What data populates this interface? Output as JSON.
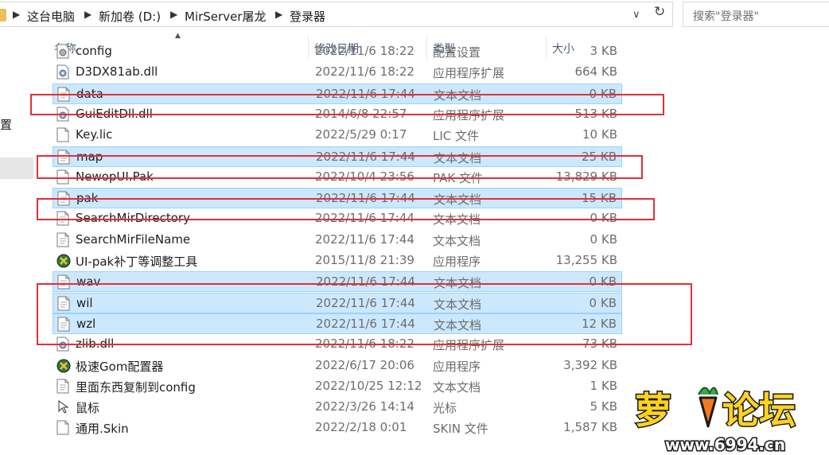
{
  "address_bar": {
    "breadcrumbs": [
      "这台电脑",
      "新加卷 (D:)",
      "MirServer屠龙",
      "登录器"
    ],
    "search_placeholder": "搜索\"登录器\""
  },
  "nav": {
    "partial_label": "置"
  },
  "columns": {
    "name": "名称",
    "date": "修改日期",
    "type": "类型",
    "size": "大小"
  },
  "files": [
    {
      "name": "config",
      "date": "2022/11/6 18:22",
      "type": "配置设置",
      "size": "3 KB",
      "icon": "config-file-icon",
      "selected": false
    },
    {
      "name": "D3DX81ab.dll",
      "date": "2022/11/6 18:22",
      "type": "应用程序扩展",
      "size": "664 KB",
      "icon": "dll-file-icon",
      "selected": false
    },
    {
      "name": "data",
      "date": "2022/11/6 17:44",
      "type": "文本文档",
      "size": "0 KB",
      "icon": "text-file-icon",
      "selected": true
    },
    {
      "name": "GuiEditDll.dll",
      "date": "2014/6/8 22:57",
      "type": "应用程序扩展",
      "size": "513 KB",
      "icon": "dll-file-icon",
      "selected": false
    },
    {
      "name": "Key.lic",
      "date": "2022/5/29 0:17",
      "type": "LIC 文件",
      "size": "10 KB",
      "icon": "generic-file-icon",
      "selected": false
    },
    {
      "name": "map",
      "date": "2022/11/6 17:44",
      "type": "文本文档",
      "size": "25 KB",
      "icon": "text-file-icon",
      "selected": true
    },
    {
      "name": "NewopUI.Pak",
      "date": "2022/10/4 23:56",
      "type": "PAK 文件",
      "size": "13,829 KB",
      "icon": "generic-file-icon",
      "selected": false
    },
    {
      "name": "pak",
      "date": "2022/11/6 17:44",
      "type": "文本文档",
      "size": "15 KB",
      "icon": "text-file-icon",
      "selected": true
    },
    {
      "name": "SearchMirDirectory",
      "date": "2022/11/6 17:44",
      "type": "文本文档",
      "size": "0 KB",
      "icon": "text-file-icon",
      "selected": false
    },
    {
      "name": "SearchMirFileName",
      "date": "2022/11/6 17:44",
      "type": "文本文档",
      "size": "0 KB",
      "icon": "text-file-icon",
      "selected": false
    },
    {
      "name": "UI-pak补丁等调整工具",
      "date": "2015/11/8 21:39",
      "type": "应用程序",
      "size": "13,255 KB",
      "icon": "application-icon",
      "selected": false
    },
    {
      "name": "wav",
      "date": "2022/11/6 17:44",
      "type": "文本文档",
      "size": "0 KB",
      "icon": "text-file-icon",
      "selected": true
    },
    {
      "name": "wil",
      "date": "2022/11/6 17:44",
      "type": "文本文档",
      "size": "0 KB",
      "icon": "text-file-icon",
      "selected": true
    },
    {
      "name": "wzl",
      "date": "2022/11/6 17:44",
      "type": "文本文档",
      "size": "12 KB",
      "icon": "text-file-icon",
      "selected": true
    },
    {
      "name": "zlib.dll",
      "date": "2022/11/6 18:22",
      "type": "应用程序扩展",
      "size": "73 KB",
      "icon": "dll-file-icon",
      "selected": false
    },
    {
      "name": "极速Gom配置器",
      "date": "2022/6/17 20:06",
      "type": "应用程序",
      "size": "3,392 KB",
      "icon": "application-icon",
      "selected": false
    },
    {
      "name": "里面东西复制到config",
      "date": "2022/10/25 12:12",
      "type": "文本文档",
      "size": "1 KB",
      "icon": "text-file-icon",
      "selected": false
    },
    {
      "name": "鼠标",
      "date": "2022/3/26 14:14",
      "type": "光标",
      "size": "5 KB",
      "icon": "cursor-file-icon",
      "selected": false
    },
    {
      "name": "通用.Skin",
      "date": "2022/2/18 0:01",
      "type": "SKIN 文件",
      "size": "1,587 KB",
      "icon": "generic-file-icon",
      "selected": false
    }
  ],
  "watermark": {
    "brand": "萝卜论坛",
    "url": "www.6994.cn"
  },
  "colors": {
    "selection": "#cce8ff",
    "selection_border": "#99d1ff",
    "annotation_red": "#e0303a",
    "header_text": "#4c607a"
  }
}
